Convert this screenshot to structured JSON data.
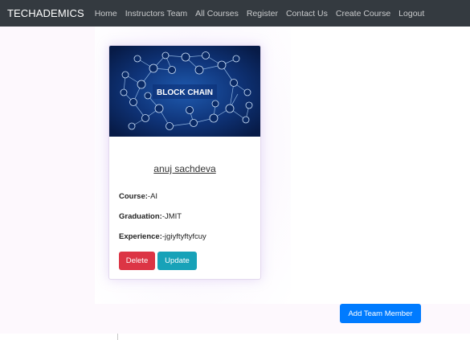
{
  "navbar": {
    "brand": "TECHADEMICS",
    "links": [
      "Home",
      "Instructors Team",
      "All Courses",
      "Register",
      "Contact Us",
      "Create Course",
      "Logout"
    ]
  },
  "card": {
    "image_label": "BLOCK CHAIN",
    "name": "anuj sachdeva",
    "course_label": "Course:",
    "course_value": "-AI",
    "graduation_label": "Graduation:",
    "graduation_value": "-JMIT",
    "experience_label": "Experience:",
    "experience_value": "-jgiyftyftyfcuy",
    "delete_label": "Delete",
    "update_label": "Update"
  },
  "add_member_label": "Add Team Member",
  "colors": {
    "navbar_bg": "#343a40",
    "danger": "#dc3545",
    "info": "#17a2b8",
    "primary": "#007bff"
  }
}
